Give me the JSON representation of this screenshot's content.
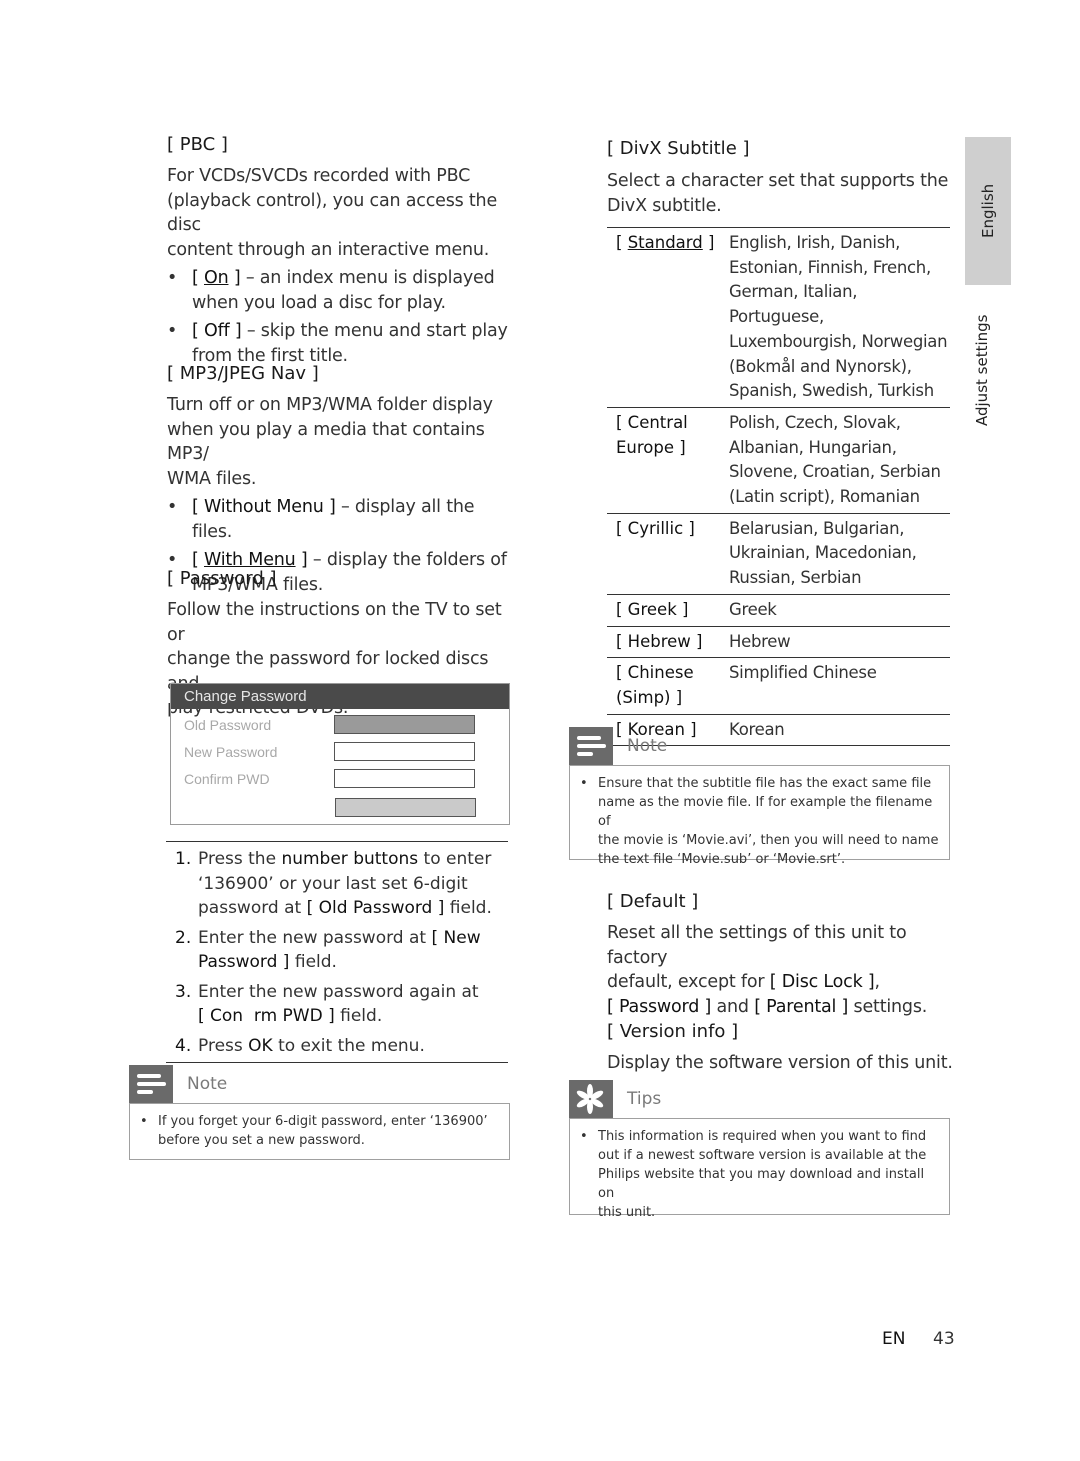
{
  "side_tabs": {
    "language": "English",
    "section": "Adjust settings"
  },
  "left": {
    "pbc": {
      "heading": "[ PBC ]",
      "desc": [
        "For VCDs/SVCDs recorded with PBC",
        "(playback control), you can access the disc",
        "content through an interactive menu."
      ],
      "options": [
        {
          "open": "[ ",
          "name": "On",
          "close": " ]",
          "text": " – an index menu is displayed",
          "text2": "when you load a disc for play.",
          "default": true
        },
        {
          "open": "[ ",
          "name": "Off",
          "close": " ]",
          "text": " – skip the menu and start play",
          "text2": "from the first title.",
          "default": false
        }
      ]
    },
    "mp3": {
      "heading": "[ MP3/JPEG Nav ]",
      "desc": [
        "Turn off or on MP3/WMA folder display",
        "when you play a media that contains MP3/",
        "WMA files."
      ],
      "options": [
        {
          "open": "[ ",
          "name": "Without Menu",
          "close": " ]",
          "text": " – display all the files.",
          "text2": "",
          "default": false
        },
        {
          "open": "[ ",
          "name": "With Menu",
          "close": " ]",
          "text": " – display the folders of",
          "text2": "MP3/WMA files.",
          "default": true
        }
      ]
    },
    "password": {
      "heading": "[ Password ]",
      "desc": [
        "Follow the instructions on the TV to set or",
        "change the password for locked discs and",
        "play restricted DVDs."
      ],
      "dialog": {
        "title": "Change Password",
        "fields": [
          "Old Password",
          "New Password",
          "Confirm PWD"
        ]
      },
      "steps": [
        {
          "n": "1.",
          "pre": "Press the ",
          "b1": "number buttons",
          "mid": " to enter",
          "l2": "‘136900’ or your last set 6-digit",
          "l3pre": "password at ",
          "b2": "[ Old Password ]",
          "l3post": " field."
        },
        {
          "n": "2.",
          "pre": "Enter the new password at ",
          "b1": "[ New",
          "l2b": "Password ]",
          "l2post": " field."
        },
        {
          "n": "3.",
          "pre": "Enter the new password again at",
          "l2b": "[ Con  rm PWD ]",
          "l2post": " field."
        },
        {
          "n": "4.",
          "pre": "Press ",
          "b1": "OK",
          "post": " to exit the menu."
        }
      ],
      "note": {
        "label": "Note",
        "bullet": "•",
        "text": [
          "If you forget your 6-digit password, enter ‘136900’",
          "before you set a new password."
        ]
      }
    }
  },
  "right": {
    "divx": {
      "heading": "[ DivX Subtitle ]",
      "desc": [
        "Select a character set that supports the",
        "DivX subtitle."
      ],
      "rows": [
        {
          "key": [
            "[ ",
            "Standard",
            " ]"
          ],
          "underline": true,
          "value": [
            "English, Irish, Danish,",
            "Estonian, Finnish, French,",
            "German, Italian, Portuguese,",
            "Luxembourgish, Norwegian",
            "(Bokmål and Nynorsk),",
            "Spanish, Swedish, Turkish"
          ]
        },
        {
          "key": [
            "[ Central",
            "Europe ]"
          ],
          "value": [
            "Polish, Czech, Slovak,",
            "Albanian, Hungarian,",
            "Slovene, Croatian, Serbian",
            "(Latin script), Romanian"
          ]
        },
        {
          "key": [
            "[ Cyrillic ]"
          ],
          "value": [
            "Belarusian, Bulgarian,",
            "Ukrainian, Macedonian,",
            "Russian, Serbian"
          ]
        },
        {
          "key": [
            "[ Greek ]"
          ],
          "value": [
            "Greek"
          ]
        },
        {
          "key": [
            "[ Hebrew ]"
          ],
          "value": [
            "Hebrew"
          ]
        },
        {
          "key": [
            "[ Chinese",
            "(Simp) ]"
          ],
          "value": [
            "Simplified Chinese"
          ]
        },
        {
          "key": [
            "[ Korean ]"
          ],
          "value": [
            "Korean"
          ]
        }
      ],
      "note": {
        "label": "Note",
        "bullet": "•",
        "text": [
          "Ensure that the subtitle file has the exact same file",
          "name as the movie file. If for example the filename of",
          "the movie is ‘Movie.avi’, then you will need to name",
          "the text file ‘Movie.sub’ or ‘Movie.srt’."
        ]
      }
    },
    "default": {
      "heading": "[ Default ]",
      "l1": "Reset all the settings of this unit to factory",
      "l2pre": "default, except for ",
      "l2b": "[ Disc Lock ]",
      "l2post": ",",
      "l3b1": "[ Password ]",
      "l3mid": " and ",
      "l3b2": "[ Parental ]",
      "l3post": " settings."
    },
    "version": {
      "heading": "[ Version info ]",
      "desc": "Display the software version of this unit.",
      "tips": {
        "label": "Tips",
        "bullet": "•",
        "text": [
          "This information is required when you want to find",
          "out if a newest software version is available at the",
          "Philips website that you may download and install on",
          "this unit."
        ]
      }
    }
  },
  "footer": {
    "lang": "EN",
    "page": "43"
  }
}
